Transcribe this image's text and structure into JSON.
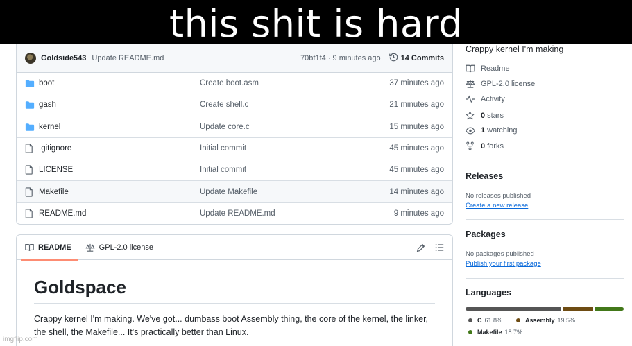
{
  "meme": {
    "caption": "this shit is hard"
  },
  "commit": {
    "author": "Goldside543",
    "message": "Update README.md",
    "hash_time": "70bf1f4 · 9 minutes ago",
    "commits_label": "14 Commits"
  },
  "files": [
    {
      "type": "folder",
      "name": "boot",
      "commit": "Create boot.asm",
      "time": "37 minutes ago"
    },
    {
      "type": "folder",
      "name": "gash",
      "commit": "Create shell.c",
      "time": "21 minutes ago"
    },
    {
      "type": "folder",
      "name": "kernel",
      "commit": "Update core.c",
      "time": "15 minutes ago"
    },
    {
      "type": "file",
      "name": ".gitignore",
      "commit": "Initial commit",
      "time": "45 minutes ago"
    },
    {
      "type": "file",
      "name": "LICENSE",
      "commit": "Initial commit",
      "time": "45 minutes ago"
    },
    {
      "type": "file",
      "name": "Makefile",
      "commit": "Update Makefile",
      "time": "14 minutes ago"
    },
    {
      "type": "file",
      "name": "README.md",
      "commit": "Update README.md",
      "time": "9 minutes ago"
    }
  ],
  "readme": {
    "tab_readme": "README",
    "tab_license": "GPL-2.0 license",
    "title": "Goldspace",
    "body": "Crappy kernel I'm making. We've got... dumbass boot Assembly thing, the core of the kernel, the linker, the shell, the Makefile... It's practically better than Linux."
  },
  "sidebar": {
    "about": "Crappy kernel I'm making",
    "readme_link": "Readme",
    "license_link": "GPL-2.0 license",
    "activity_link": "Activity",
    "stars_count": "0",
    "stars_label": "stars",
    "watching_count": "1",
    "watching_label": "watching",
    "forks_count": "0",
    "forks_label": "forks",
    "releases_title": "Releases",
    "releases_note": "No releases published",
    "releases_action": "Create a new release",
    "packages_title": "Packages",
    "packages_note": "No packages published",
    "packages_action": "Publish your first package",
    "languages_title": "Languages"
  },
  "languages": [
    {
      "name": "C",
      "percent": "61.8%",
      "share": 61.8,
      "color": "#555555"
    },
    {
      "name": "Assembly",
      "percent": "19.5%",
      "share": 19.5,
      "color": "#6E4C13"
    },
    {
      "name": "Makefile",
      "percent": "18.7%",
      "share": 18.7,
      "color": "#427819"
    }
  ],
  "watermark": "imgflip.com"
}
